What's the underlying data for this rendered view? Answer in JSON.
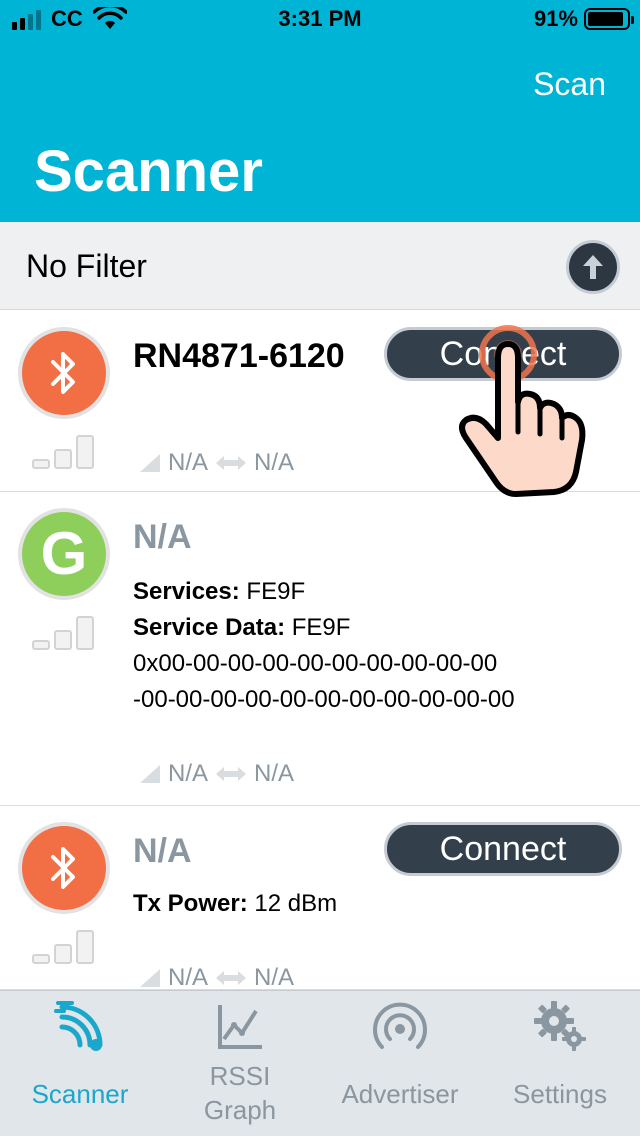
{
  "status_bar": {
    "carrier": "CC",
    "time": "3:31 PM",
    "battery": "91%"
  },
  "header": {
    "scan_label": "Scan",
    "title": "Scanner"
  },
  "filter": {
    "label": "No Filter"
  },
  "devices": [
    {
      "name": "RN4871-6120",
      "icon": "bluetooth-icon",
      "rssi": "N/A",
      "interval": "N/A",
      "connect_label": "Connect"
    },
    {
      "name": "N/A",
      "icon": "google-g-icon",
      "icon_letter": "G",
      "services_label": "Services:",
      "services_value": "FE9F",
      "service_data_label": "Service Data:",
      "service_data_value": "FE9F",
      "service_data_line1": "0x00-00-00-00-00-00-00-00-00-00",
      "service_data_line2": "-00-00-00-00-00-00-00-00-00-00-00",
      "rssi": "N/A",
      "interval": "N/A"
    },
    {
      "name": "N/A",
      "icon": "bluetooth-icon",
      "tx_label": "Tx Power:",
      "tx_value": "12 dBm",
      "rssi": "N/A",
      "interval": "N/A",
      "connect_label": "Connect"
    }
  ],
  "tabs": [
    {
      "label": "Scanner",
      "icon": "scanner-waves-icon",
      "active": true
    },
    {
      "label_line1": "RSSI",
      "label_line2": "Graph",
      "icon": "graph-icon",
      "active": false
    },
    {
      "label": "Advertiser",
      "icon": "broadcast-icon",
      "active": false
    },
    {
      "label": "Settings",
      "icon": "gears-icon",
      "active": false
    }
  ],
  "colors": {
    "header": "#00b4d6",
    "bluetooth_badge": "#f26e45",
    "google_badge": "#8ecf5c",
    "button_dark": "#33404b",
    "tab_active": "#1aa7cc",
    "muted_text": "#8a96a0"
  }
}
